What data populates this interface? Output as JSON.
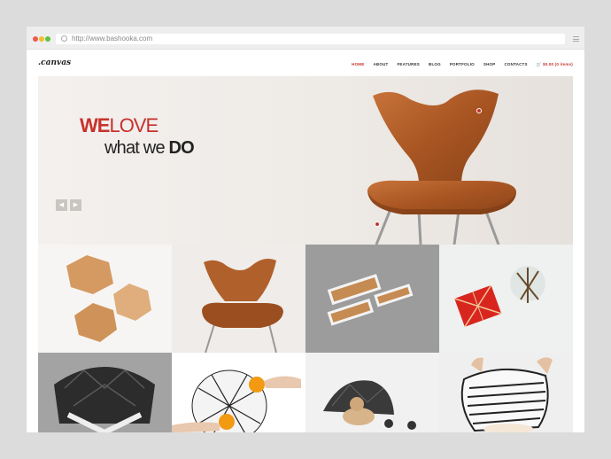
{
  "browser": {
    "url": "http://www.bashooka.com"
  },
  "site": {
    "logo": ".canvas",
    "nav": [
      "HOME",
      "ABOUT",
      "FEATURES",
      "BLOG",
      "PORTFOLIO",
      "SHOP",
      "CONTACTS"
    ],
    "cart": "$0.00 (0 items)"
  },
  "hero": {
    "line1_bold": "WE",
    "line1_rest": "LOVE",
    "line2_rest": "what we ",
    "line2_bold": "DO",
    "prev_icon": "chevron-left-icon",
    "next_icon": "chevron-right-icon"
  },
  "colors": {
    "accent": "#c7322c"
  }
}
